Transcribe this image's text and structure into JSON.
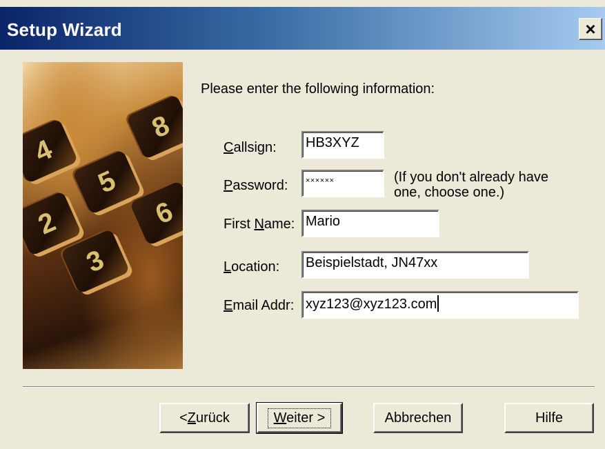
{
  "window": {
    "title": "Setup Wizard",
    "close_glyph": "×"
  },
  "intro": "Please enter the following information:",
  "fields": {
    "callsign": {
      "label_prefix": "",
      "label_accel": "C",
      "label_rest": "allsign:",
      "value": "HB3XYZ"
    },
    "password": {
      "label_prefix": "",
      "label_accel": "P",
      "label_rest": "assword:",
      "value": "××××××",
      "hint_line1": "(If you don't already have",
      "hint_line2": "one, choose one.)"
    },
    "first_name": {
      "label_prefix": "First ",
      "label_accel": "N",
      "label_rest": "ame:",
      "value": "Mario"
    },
    "location": {
      "label_prefix": "",
      "label_accel": "L",
      "label_rest": "ocation:",
      "value": "Beispielstadt, JN47xx"
    },
    "email": {
      "label_prefix": "",
      "label_accel": "E",
      "label_rest": "mail Addr:",
      "value": "xyz123@xyz123.com"
    }
  },
  "image": {
    "keys": [
      "4",
      "5",
      "6",
      "2",
      "3",
      "8"
    ]
  },
  "buttons": {
    "back": {
      "prefix": "< ",
      "accel": "Z",
      "rest": "urück"
    },
    "next": {
      "prefix": "",
      "accel": "W",
      "rest": "eiter >"
    },
    "cancel": {
      "label": "Abbrechen"
    },
    "help": {
      "label": "Hilfe"
    }
  },
  "colors": {
    "title_start": "#0a246a",
    "title_end": "#a6caf0",
    "dialog_bg": "#ece9d8"
  }
}
